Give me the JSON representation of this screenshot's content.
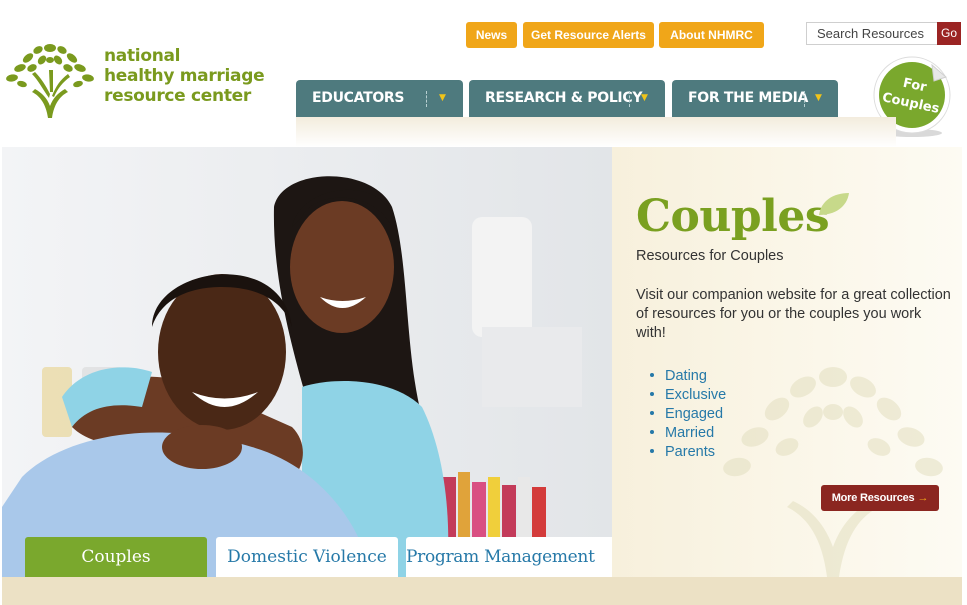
{
  "brand": {
    "line1": "national",
    "line2": "healthy marriage",
    "line3": "resource center"
  },
  "top_links": {
    "news": "News",
    "alerts": "Get Resource Alerts",
    "about": "About NHMRC"
  },
  "search": {
    "placeholder": "Search Resources",
    "go_label": "Go"
  },
  "nav": [
    {
      "label": "EDUCATORS"
    },
    {
      "label": "RESEARCH & POLICY"
    },
    {
      "label": "FOR THE MEDIA"
    }
  ],
  "sticker": {
    "line1": "For",
    "line2": "Couples"
  },
  "hero": {
    "title": "Couples",
    "subtitle": "Resources for Couples",
    "description": "Visit our companion website for a great collection of resources for you or the couples you work with!",
    "links": [
      "Dating",
      "Exclusive",
      "Engaged",
      "Married",
      "Parents"
    ],
    "more_label": "More Resources",
    "more_arrow": "→"
  },
  "tabs": [
    {
      "label": "Couples",
      "active": true
    },
    {
      "label": "Domestic Violence",
      "active": false
    },
    {
      "label": "Program Management",
      "active": false
    }
  ],
  "colors": {
    "brand_green": "#7a9a1e",
    "nav_teal": "#4e7a7e",
    "orange": "#f0a619",
    "maroon": "#8b2620",
    "link_blue": "#2679a8",
    "tab_green": "#7aa82d"
  },
  "icons": {
    "logo": "tree-logo-icon",
    "leaf": "leaf-icon",
    "dropdown": "chevron-down-icon",
    "arrow": "arrow-right-icon"
  }
}
